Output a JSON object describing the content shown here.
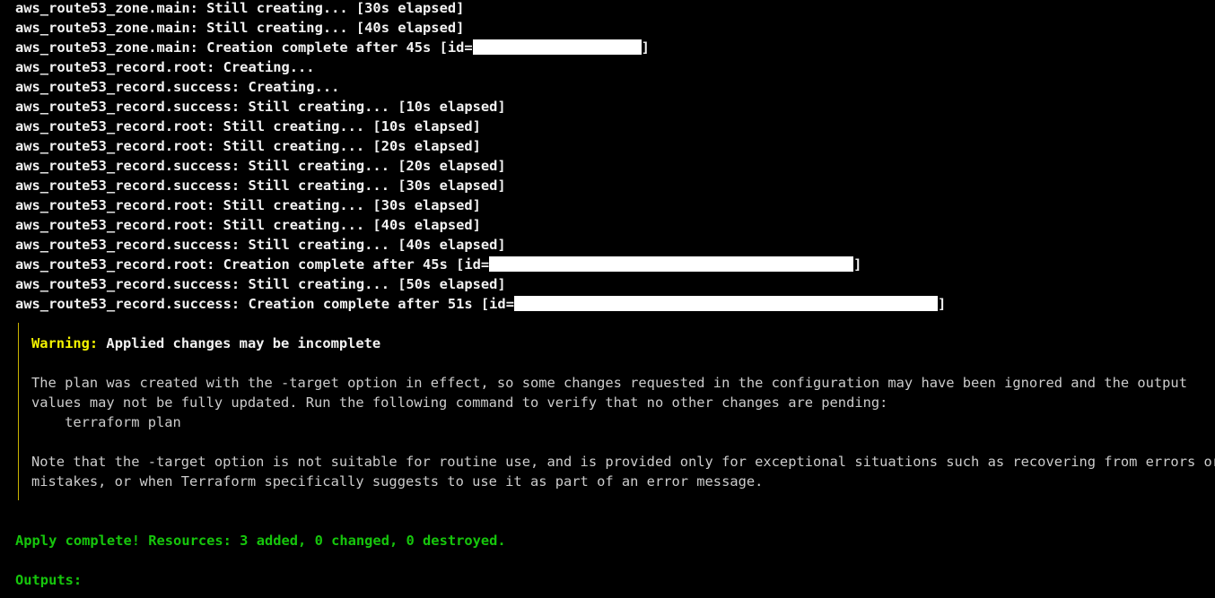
{
  "terminal": {
    "log_lines": [
      {
        "text": "aws_route53_zone.main: Still creating... [30s elapsed]"
      },
      {
        "text": "aws_route53_zone.main: Still creating... [40s elapsed]"
      },
      {
        "text": "aws_route53_zone.main: Creation complete after 45s [id=",
        "suffix": "]"
      },
      {
        "text": "aws_route53_record.root: Creating..."
      },
      {
        "text": "aws_route53_record.success: Creating..."
      },
      {
        "text": "aws_route53_record.success: Still creating... [10s elapsed]"
      },
      {
        "text": "aws_route53_record.root: Still creating... [10s elapsed]"
      },
      {
        "text": "aws_route53_record.root: Still creating... [20s elapsed]"
      },
      {
        "text": "aws_route53_record.success: Still creating... [20s elapsed]"
      },
      {
        "text": "aws_route53_record.success: Still creating... [30s elapsed]"
      },
      {
        "text": "aws_route53_record.root: Still creating... [30s elapsed]"
      },
      {
        "text": "aws_route53_record.root: Still creating... [40s elapsed]"
      },
      {
        "text": "aws_route53_record.success: Still creating... [40s elapsed]"
      },
      {
        "text": "aws_route53_record.root: Creation complete after 45s [id=",
        "suffix": "]"
      },
      {
        "text": "aws_route53_record.success: Still creating... [50s elapsed]"
      },
      {
        "text": "aws_route53_record.success: Creation complete after 51s [id=",
        "suffix": "]"
      }
    ],
    "warning": {
      "label": "Warning:",
      "title": "Applied changes may be incomplete",
      "para1_line1": "The plan was created with the -target option in effect, so some changes requested in the configuration may have been ignored and the output",
      "para1_line2": "values may not be fully updated. Run the following command to verify that no other changes are pending:",
      "command": "    terraform plan",
      "para2_line1": "Note that the -target option is not suitable for routine use, and is provided only for exceptional situations such as recovering from errors or",
      "para2_line2": "mistakes, or when Terraform specifically suggests to use it as part of an error message."
    },
    "apply_complete": "Apply complete! Resources: 3 added, 0 changed, 0 destroyed.",
    "outputs_label": "Outputs:"
  },
  "colors": {
    "background": "#000000",
    "text": "#cccccc",
    "warning_yellow": "#f4f400",
    "success_green": "#16c60c",
    "redaction": "#ffffff"
  }
}
